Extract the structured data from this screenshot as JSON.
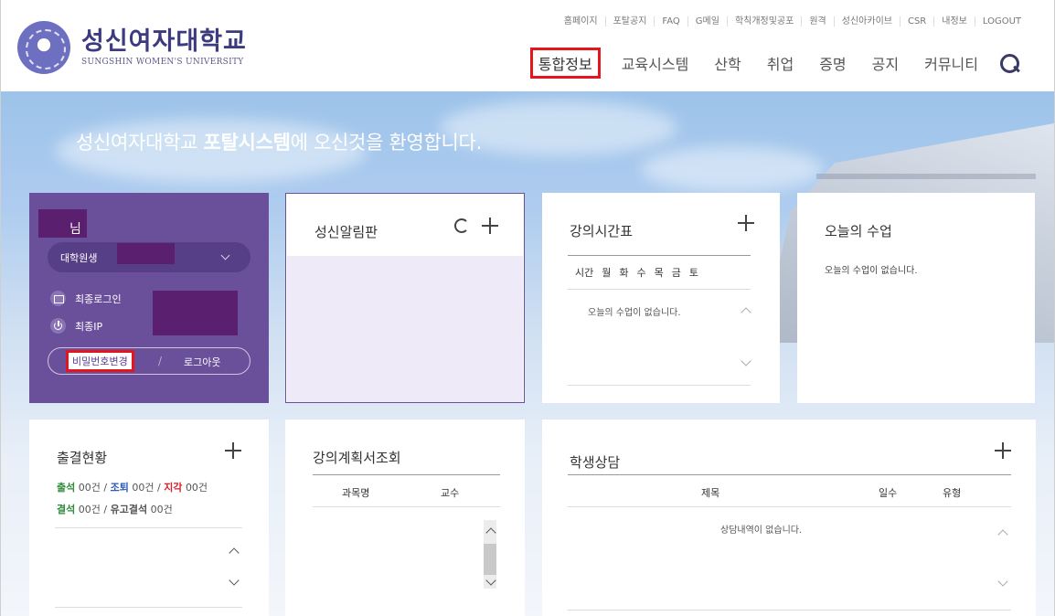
{
  "header": {
    "logo_ko": "성신여자대학교",
    "logo_en": "SUNGSHIN WOMEN'S UNIVERSITY",
    "util_links": [
      "홈페이지",
      "포탈공지",
      "FAQ",
      "G메일",
      "학칙개정및공포",
      "원격",
      "성신아카이브",
      "CSR",
      "내정보",
      "LOGOUT"
    ],
    "main_menu": [
      "통합정보",
      "교육시스템",
      "산학",
      "취업",
      "증명",
      "공지",
      "커뮤니티"
    ],
    "active_menu": "통합정보"
  },
  "hero": {
    "welcome_pre": "성신여자대학교 ",
    "welcome_bold": "포탈시스템",
    "welcome_post": "에 오신것을 환영합니다."
  },
  "user_panel": {
    "name_suffix": "님",
    "status_prefix": "대학원생",
    "last_login_label": "최종로그인",
    "last_ip_label": "최종IP",
    "change_password": "비밀번호변경",
    "separator": "/",
    "logout": "로그아웃"
  },
  "notice_board": {
    "title": "성신알림판"
  },
  "timetable": {
    "title": "강의시간표",
    "days": [
      "시간",
      "월",
      "화",
      "수",
      "목",
      "금",
      "토"
    ],
    "empty": "오늘의 수업이 없습니다."
  },
  "today_class": {
    "title": "오늘의 수업",
    "empty": "오늘의 수업이 없습니다."
  },
  "attendance": {
    "title": "출결현황",
    "items": [
      {
        "label": "출석",
        "value": "00건"
      },
      {
        "label": "조퇴",
        "value": "00건"
      },
      {
        "label": "지각",
        "value": "00건"
      },
      {
        "label": "결석",
        "value": "00건"
      },
      {
        "label": "유고결석",
        "value": "00건"
      }
    ],
    "sep": "/"
  },
  "syllabus": {
    "title": "강의계획서조회",
    "columns": [
      "과목명",
      "교수"
    ]
  },
  "counseling": {
    "title": "학생상담",
    "columns": [
      "제목",
      "일수",
      "유형"
    ],
    "empty": "상담내역이 없습니다."
  },
  "colors": {
    "brand_purple": "#6a4f9a",
    "highlight_red": "#e3161d",
    "logo_navy": "#3d3b7f"
  }
}
